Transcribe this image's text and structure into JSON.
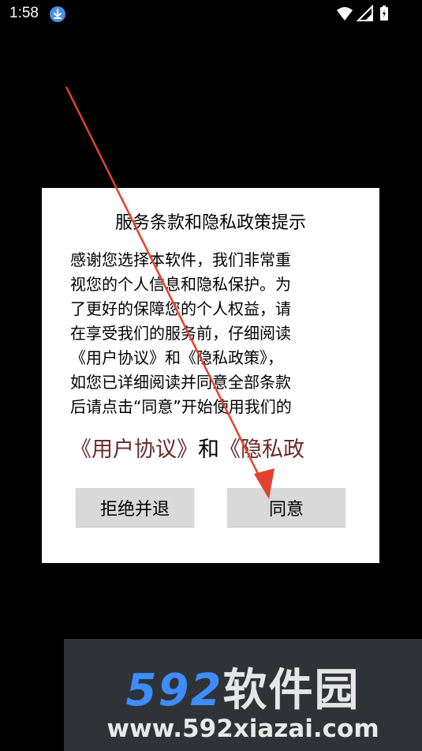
{
  "status_bar": {
    "time": "1:58",
    "icons": [
      "download-icon",
      "wifi-icon",
      "signal-icon",
      "battery-charging-icon"
    ]
  },
  "dialog": {
    "title": "服务条款和隐私政策提示",
    "body": "感谢您选择本软件，我们非常重\n视您的个人信息和隐私保护。为\n了更好的保障您的个人权益，请\n在享受我们的服务前，仔细阅读\n《用户协议》和《隐私政策》，\n如您已详细阅读并同意全部条款\n后请点击“同意”开始使用我们的",
    "link_user_agreement": "《用户协议》",
    "link_and": "和",
    "link_privacy_policy": "《隐私政",
    "buttons": {
      "reject": "拒绝并退",
      "agree": "同意"
    }
  },
  "annotation": {
    "arrow_color": "#e0432e"
  },
  "watermark": {
    "number": "592",
    "brand": "软件园",
    "url": "www.592xiazai.com"
  },
  "colors": {
    "link": "#6b2b2b",
    "button_bg": "#d9d9d9",
    "watermark_blue": "#3f8cff"
  }
}
